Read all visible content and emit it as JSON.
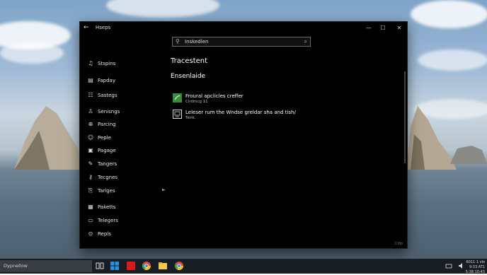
{
  "window": {
    "title": "Hseps",
    "back_glyph": "←",
    "controls": {
      "minimize": "—",
      "maximize": "☐",
      "close": "✕"
    },
    "corner_label": "Ciflo"
  },
  "search": {
    "value": "Inskedlen",
    "search_glyph": "⚲",
    "submit_glyph": "⌕"
  },
  "sidebar": {
    "items": [
      {
        "label": "Stspins",
        "icon": "music-note-icon",
        "glyph": "♫"
      },
      {
        "label": "Fapday",
        "icon": "document-icon",
        "glyph": "▤"
      },
      {
        "label": "Sastegs",
        "icon": "list-icon",
        "glyph": "☷"
      },
      {
        "label": "Senisngs",
        "icon": "person-icon",
        "glyph": "♙"
      },
      {
        "label": "Parcing",
        "icon": "globe-icon",
        "glyph": "⊕"
      },
      {
        "label": "Peple",
        "icon": "user-icon",
        "glyph": "☺"
      },
      {
        "label": "Pagage",
        "icon": "package-icon",
        "glyph": "▣"
      },
      {
        "label": "Tangers",
        "icon": "pin-icon",
        "glyph": "✎"
      },
      {
        "label": "Tecgnes",
        "icon": "key-icon",
        "glyph": "⚷"
      },
      {
        "label": "Tarlges",
        "icon": "tag-icon",
        "glyph": "⎘"
      },
      {
        "label": "Paketts",
        "icon": "folder-icon",
        "glyph": "▦"
      },
      {
        "label": "Telegers",
        "icon": "chat-icon",
        "glyph": "▭"
      },
      {
        "label": "Repls",
        "icon": "settings-icon",
        "glyph": "⊙"
      }
    ],
    "expander_glyph": "►"
  },
  "main": {
    "heading": "Tracestent",
    "subheading": "Ensenlaide",
    "results": [
      {
        "title": "Froural apclicles creffer",
        "subtitle": "Cirdmcg 11",
        "icon": "app-icon-green"
      },
      {
        "title": "Leleser rum the Wndse greldar sha and tish/",
        "subtitle": "Terik.",
        "icon": "monitor-icon"
      }
    ]
  },
  "taskbar": {
    "search_placeholder": "Dypnellow",
    "tray_line1": "6011 1 vlo",
    "tray_line2": "9:33 AT1",
    "tray_line3": "5:38 10:43"
  },
  "colors": {
    "window_bg": "#000000",
    "accent_green": "#3d8a3d"
  }
}
